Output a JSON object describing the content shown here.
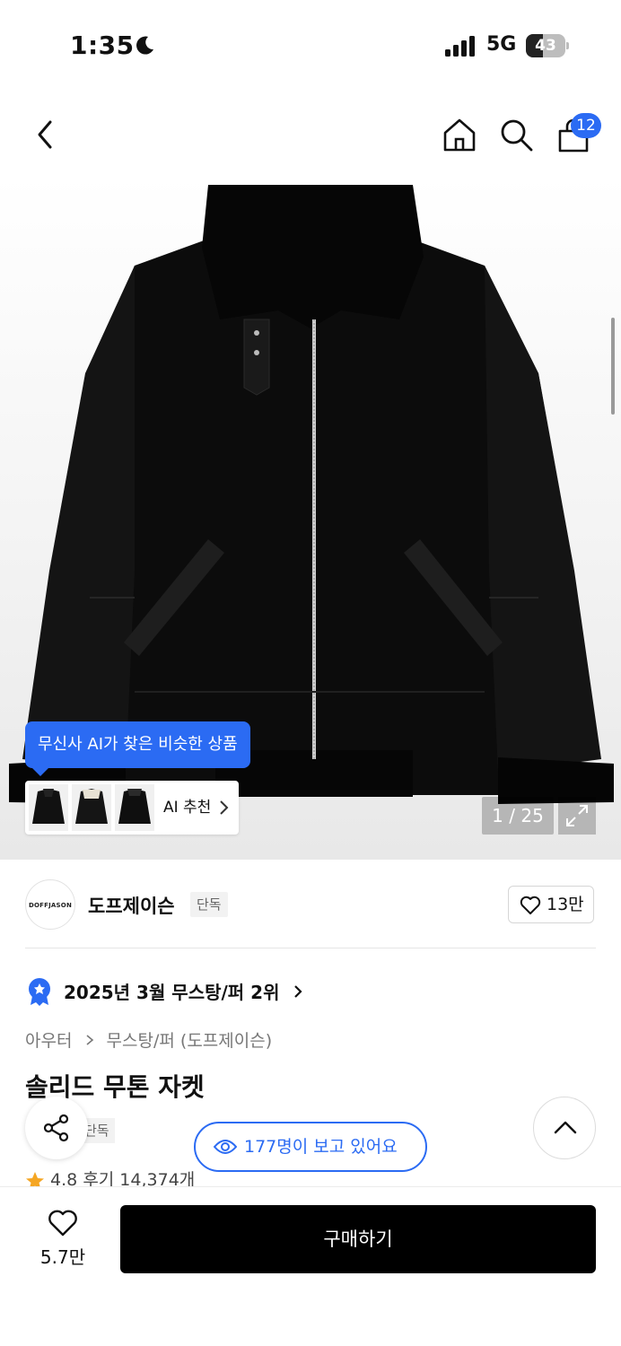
{
  "status_bar": {
    "time": "1:35",
    "network": "5G",
    "battery_level": "43",
    "battery_fraction": 0.43
  },
  "nav": {
    "back_icon": "chevron-left-icon",
    "home_icon": "home-icon",
    "search_icon": "search-icon",
    "cart_icon": "shopping-bag-icon",
    "cart_badge": "12"
  },
  "gallery": {
    "ai_tooltip": "무신사 AI가 찾은 비슷한 상품",
    "ai_recommend_label": "AI 추천",
    "image_counter": "1 / 25",
    "expand_icon": "expand-icon",
    "accent_color": "#2b6bf3"
  },
  "brand": {
    "name": "도프제이슨",
    "tag": "단독",
    "logo_text": "DOFFJASON",
    "like_count": "13만"
  },
  "product": {
    "ranking": "2025년 3월 무스탕/퍼 2위",
    "breadcrumb": [
      "아우터",
      "무스탕/퍼 (도프제이슨)"
    ],
    "title": "솔리드 무톤 자켓",
    "exclusive_tag": "단독",
    "rating": "4.8",
    "reviews": "후기 14,374개",
    "viewers": "177명이 보고 있어요"
  },
  "bottom_bar": {
    "wish_count": "5.7만",
    "buy_label": "구매하기"
  }
}
